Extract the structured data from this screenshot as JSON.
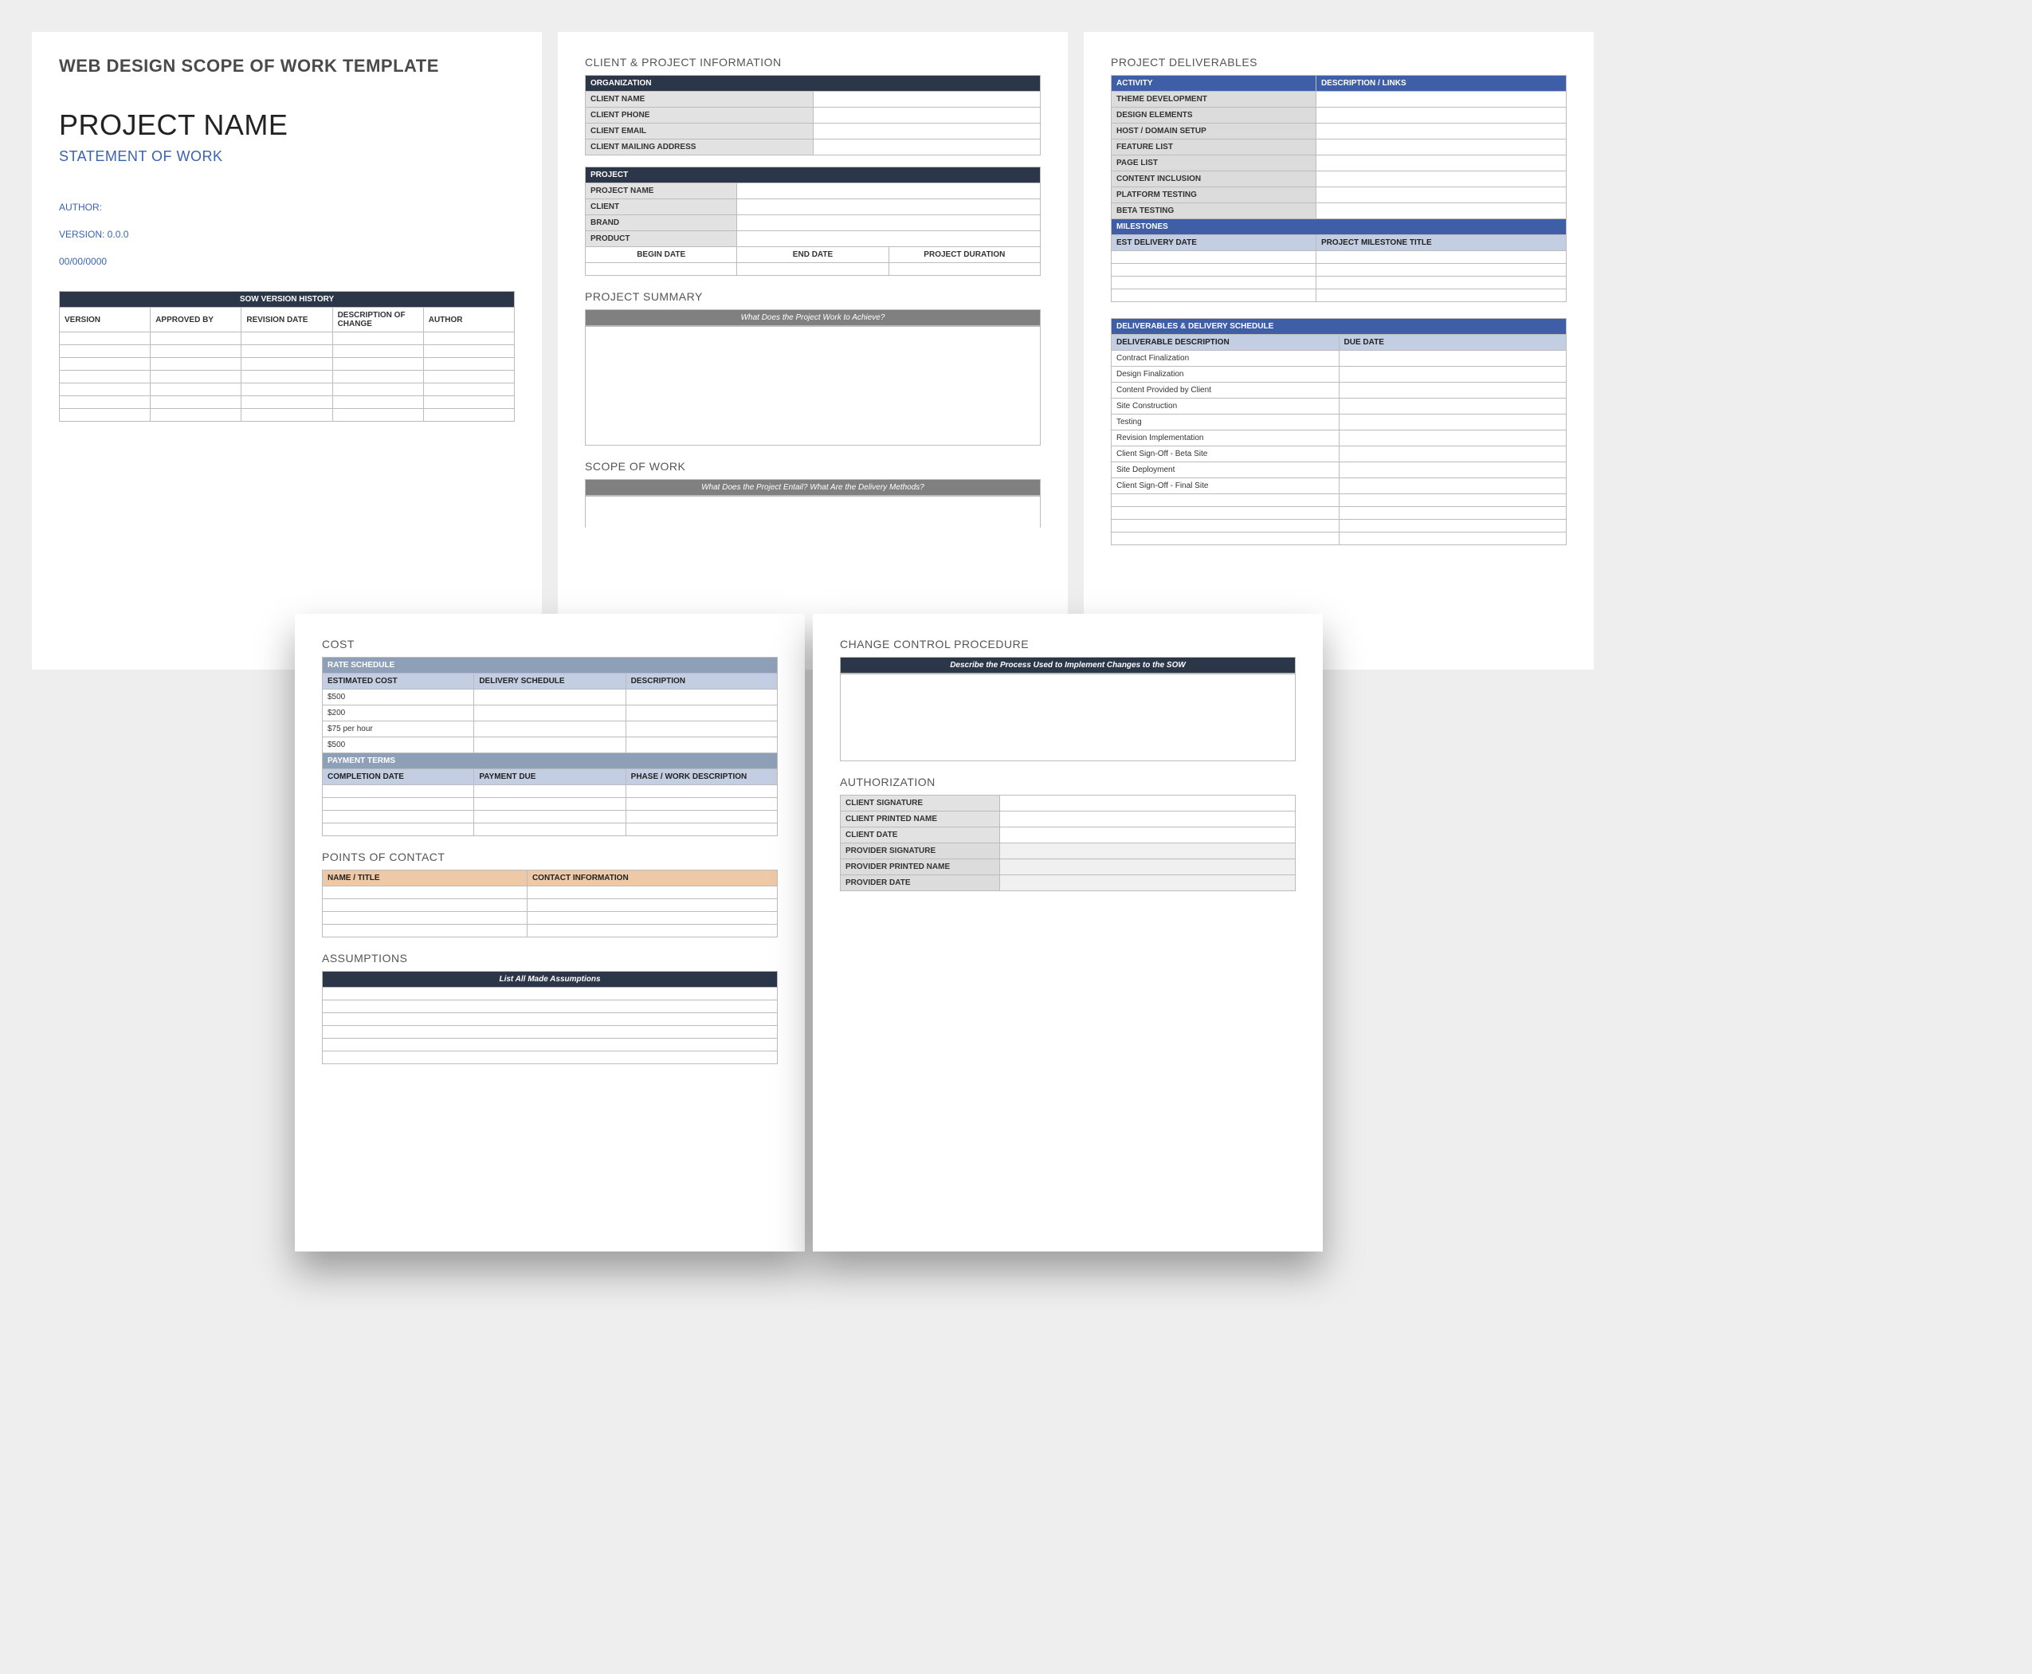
{
  "page1": {
    "template_title": "WEB DESIGN SCOPE OF WORK TEMPLATE",
    "project_title": "PROJECT NAME",
    "subtitle": "STATEMENT OF WORK",
    "author_label": "AUTHOR:",
    "version_label": "VERSION: 0.0.0",
    "date_label": "00/00/0000",
    "history_header": "SOW VERSION HISTORY",
    "history_cols": {
      "c1": "VERSION",
      "c2": "APPROVED BY",
      "c3": "REVISION DATE",
      "c4": "DESCRIPTION OF CHANGE",
      "c5": "AUTHOR"
    }
  },
  "page2": {
    "sec1": "CLIENT & PROJECT INFORMATION",
    "org_header": "ORGANIZATION",
    "org_rows": {
      "r1": "CLIENT NAME",
      "r2": "CLIENT  PHONE",
      "r3": "CLIENT EMAIL",
      "r4": "CLIENT MAILING ADDRESS"
    },
    "proj_header": "PROJECT",
    "proj_rows": {
      "r1": "PROJECT NAME",
      "r2": "CLIENT",
      "r3": "BRAND",
      "r4": "PRODUCT"
    },
    "dates": {
      "c1": "BEGIN DATE",
      "c2": "END DATE",
      "c3": "PROJECT DURATION"
    },
    "sec2": "PROJECT SUMMARY",
    "sum_prompt": "What Does the Project Work to Achieve?",
    "sec3": "SCOPE OF WORK",
    "scope_prompt": "What Does the Project Entail? What Are the Delivery Methods?"
  },
  "page3": {
    "sec1": "PROJECT DELIVERABLES",
    "activity_cols": {
      "c1": "ACTIVITY",
      "c2": "DESCRIPTION / LINKS"
    },
    "activity_rows": {
      "r1": "THEME DEVELOPMENT",
      "r2": "DESIGN ELEMENTS",
      "r3": "HOST / DOMAIN SETUP",
      "r4": "FEATURE LIST",
      "r5": "PAGE LIST",
      "r6": "CONTENT INCLUSION",
      "r7": "PLATFORM TESTING",
      "r8": "BETA TESTING"
    },
    "milestones_header": "MILESTONES",
    "milestones_cols": {
      "c1": "EST DELIVERY DATE",
      "c2": "PROJECT MILESTONE TITLE"
    },
    "schedule_header": "DELIVERABLES & DELIVERY SCHEDULE",
    "schedule_cols": {
      "c1": "DELIVERABLE DESCRIPTION",
      "c2": "DUE DATE"
    },
    "schedule_rows": {
      "r1": "Contract Finalization",
      "r2": "Design Finalization",
      "r3": "Content Provided by Client",
      "r4": "Site Construction",
      "r5": "Testing",
      "r6": "Revision Implementation",
      "r7": "Client Sign-Off - Beta Site",
      "r8": "Site Deployment",
      "r9": "Client Sign-Off - Final Site"
    }
  },
  "page4": {
    "sec1": "COST",
    "rate_header": "RATE SCHEDULE",
    "rate_cols": {
      "c1": "ESTIMATED COST",
      "c2": "DELIVERY SCHEDULE",
      "c3": "DESCRIPTION"
    },
    "rate_rows": {
      "r1": "$500",
      "r2": "$200",
      "r3": "$75 per hour",
      "r4": "$500"
    },
    "pay_header": "PAYMENT TERMS",
    "pay_cols": {
      "c1": "COMPLETION DATE",
      "c2": "PAYMENT DUE",
      "c3": "PHASE / WORK DESCRIPTION"
    },
    "sec2": "POINTS OF CONTACT",
    "poc_cols": {
      "c1": "NAME / TITLE",
      "c2": "CONTACT INFORMATION"
    },
    "sec3": "ASSUMPTIONS",
    "assump_prompt": "List All Made Assumptions"
  },
  "page5": {
    "sec1": "CHANGE CONTROL PROCEDURE",
    "change_prompt": "Describe the Process Used to Implement Changes to the SOW",
    "sec2": "AUTHORIZATION",
    "auth_rows": {
      "r1": "CLIENT SIGNATURE",
      "r2": "CLIENT PRINTED NAME",
      "r3": "CLIENT DATE",
      "r4": "PROVIDER SIGNATURE",
      "r5": "PROVIDER PRINTED NAME",
      "r6": "PROVIDER DATE"
    }
  }
}
